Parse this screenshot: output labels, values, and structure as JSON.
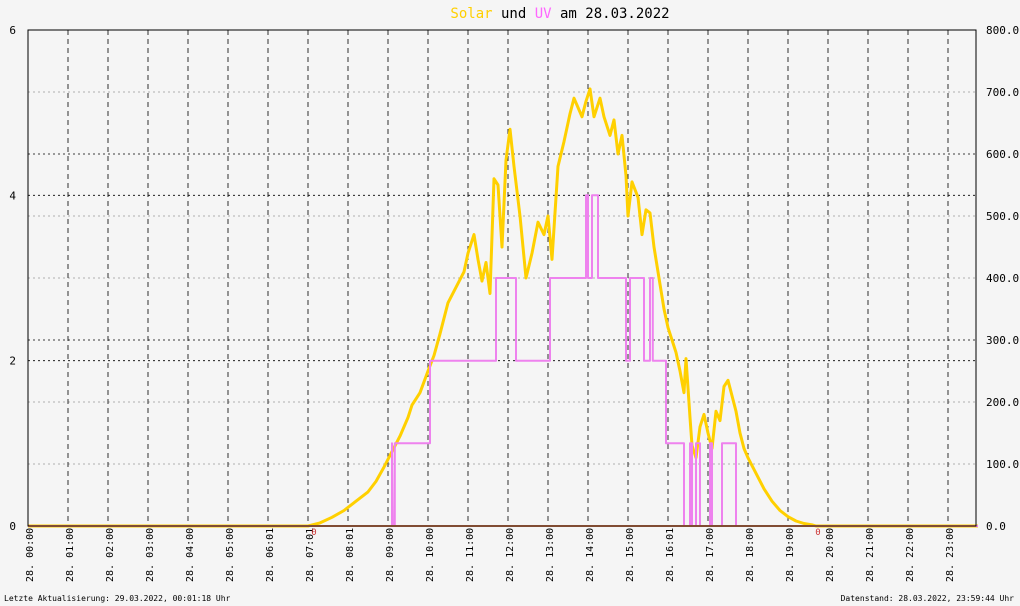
{
  "chart_data": {
    "type": "line",
    "title": {
      "parts": [
        {
          "text": "Solar",
          "color": "#ffd000"
        },
        {
          "text": " und ",
          "color": "#000000"
        },
        {
          "text": "UV",
          "color": "#ff66ff"
        },
        {
          "text": " am 28.03.2022",
          "color": "#000000"
        }
      ]
    },
    "x_axis": {
      "tick_labels": [
        "28. 00:00",
        "28. 01:00",
        "28. 02:00",
        "28. 03:00",
        "28. 04:00",
        "28. 05:00",
        "28. 06:01",
        "28. 07:01",
        "28. 08:01",
        "28. 09:00",
        "28. 10:00",
        "28. 11:00",
        "28. 12:00",
        "28. 13:00",
        "28. 14:00",
        "28. 15:00",
        "28. 16:01",
        "28. 17:00",
        "28. 18:00",
        "28. 19:00",
        "28. 20:00",
        "28. 21:00",
        "28. 22:00",
        "28. 23:00"
      ],
      "range_hours": [
        0,
        23.75
      ]
    },
    "y_left": {
      "range": [
        0,
        6
      ],
      "ticks": [
        "0",
        "2",
        "4",
        "6"
      ]
    },
    "y_right": {
      "range": [
        0,
        800
      ],
      "ticks": [
        "0.0",
        "100.0",
        "200.0",
        "300.0",
        "400.0",
        "500.0",
        "600.0",
        "700.0",
        "800.0"
      ]
    },
    "grid": true,
    "series": [
      {
        "name": "Solar",
        "axis": "right",
        "color": "#ffd000",
        "points": [
          [
            0,
            0
          ],
          [
            7.0,
            0
          ],
          [
            7.3,
            5
          ],
          [
            7.6,
            14
          ],
          [
            7.9,
            25
          ],
          [
            8.2,
            40
          ],
          [
            8.5,
            55
          ],
          [
            8.7,
            72
          ],
          [
            8.9,
            95
          ],
          [
            9.1,
            120
          ],
          [
            9.3,
            145
          ],
          [
            9.5,
            175
          ],
          [
            9.6,
            195
          ],
          [
            9.8,
            215
          ],
          [
            10.0,
            250
          ],
          [
            10.15,
            275
          ],
          [
            10.3,
            310
          ],
          [
            10.5,
            360
          ],
          [
            10.7,
            385
          ],
          [
            10.9,
            410
          ],
          [
            11.0,
            440
          ],
          [
            11.15,
            470
          ],
          [
            11.25,
            430
          ],
          [
            11.35,
            395
          ],
          [
            11.45,
            425
          ],
          [
            11.55,
            375
          ],
          [
            11.65,
            560
          ],
          [
            11.75,
            550
          ],
          [
            11.85,
            450
          ],
          [
            11.95,
            590
          ],
          [
            12.05,
            640
          ],
          [
            12.15,
            580
          ],
          [
            12.3,
            500
          ],
          [
            12.45,
            400
          ],
          [
            12.6,
            440
          ],
          [
            12.75,
            490
          ],
          [
            12.9,
            470
          ],
          [
            13.0,
            500
          ],
          [
            13.1,
            430
          ],
          [
            13.25,
            580
          ],
          [
            13.4,
            620
          ],
          [
            13.55,
            665
          ],
          [
            13.65,
            690
          ],
          [
            13.75,
            675
          ],
          [
            13.85,
            660
          ],
          [
            13.95,
            685
          ],
          [
            14.05,
            705
          ],
          [
            14.15,
            660
          ],
          [
            14.3,
            690
          ],
          [
            14.4,
            660
          ],
          [
            14.55,
            630
          ],
          [
            14.65,
            655
          ],
          [
            14.75,
            600
          ],
          [
            14.85,
            630
          ],
          [
            14.95,
            565
          ],
          [
            15.0,
            500
          ],
          [
            15.1,
            555
          ],
          [
            15.25,
            530
          ],
          [
            15.35,
            470
          ],
          [
            15.45,
            510
          ],
          [
            15.55,
            505
          ],
          [
            15.65,
            450
          ],
          [
            15.8,
            390
          ],
          [
            15.9,
            350
          ],
          [
            16.0,
            320
          ],
          [
            16.1,
            300
          ],
          [
            16.2,
            280
          ],
          [
            16.3,
            250
          ],
          [
            16.4,
            215
          ],
          [
            16.45,
            270
          ],
          [
            16.55,
            175
          ],
          [
            16.6,
            130
          ],
          [
            16.7,
            110
          ],
          [
            16.8,
            160
          ],
          [
            16.9,
            180
          ],
          [
            17.0,
            150
          ],
          [
            17.1,
            125
          ],
          [
            17.2,
            185
          ],
          [
            17.3,
            170
          ],
          [
            17.4,
            225
          ],
          [
            17.5,
            235
          ],
          [
            17.6,
            210
          ],
          [
            17.7,
            185
          ],
          [
            17.8,
            150
          ],
          [
            17.9,
            125
          ],
          [
            18.0,
            110
          ],
          [
            18.2,
            85
          ],
          [
            18.4,
            60
          ],
          [
            18.6,
            40
          ],
          [
            18.8,
            25
          ],
          [
            19.0,
            15
          ],
          [
            19.2,
            8
          ],
          [
            19.4,
            4
          ],
          [
            19.6,
            2
          ],
          [
            19.7,
            0
          ],
          [
            23.75,
            0
          ]
        ]
      },
      {
        "name": "UV",
        "axis": "left",
        "color": "#ee82ee",
        "points": [
          [
            7.0,
            0
          ],
          [
            9.1,
            0
          ],
          [
            9.1,
            1
          ],
          [
            9.12,
            0
          ],
          [
            9.17,
            0
          ],
          [
            9.17,
            1
          ],
          [
            10.05,
            1
          ],
          [
            10.05,
            2
          ],
          [
            11.7,
            2
          ],
          [
            11.7,
            3
          ],
          [
            12.2,
            3
          ],
          [
            12.2,
            2
          ],
          [
            13.05,
            2
          ],
          [
            13.05,
            3
          ],
          [
            13.95,
            3
          ],
          [
            13.95,
            4
          ],
          [
            14.0,
            4
          ],
          [
            14.0,
            3
          ],
          [
            14.1,
            3
          ],
          [
            14.1,
            4
          ],
          [
            14.25,
            4
          ],
          [
            14.25,
            3
          ],
          [
            14.95,
            3
          ],
          [
            14.95,
            2
          ],
          [
            15.05,
            2
          ],
          [
            15.05,
            3
          ],
          [
            15.4,
            3
          ],
          [
            15.4,
            2
          ],
          [
            15.55,
            2
          ],
          [
            15.55,
            3
          ],
          [
            15.62,
            3
          ],
          [
            15.62,
            2
          ],
          [
            15.95,
            2
          ],
          [
            15.95,
            1
          ],
          [
            16.4,
            1
          ],
          [
            16.4,
            0
          ],
          [
            16.55,
            0
          ],
          [
            16.55,
            1
          ],
          [
            16.6,
            1
          ],
          [
            16.6,
            0
          ],
          [
            16.7,
            0
          ],
          [
            16.7,
            1
          ],
          [
            16.8,
            1
          ],
          [
            16.8,
            0
          ],
          [
            17.05,
            0
          ],
          [
            17.05,
            1
          ],
          [
            17.1,
            1
          ],
          [
            17.1,
            0
          ],
          [
            17.35,
            0
          ],
          [
            17.35,
            1
          ],
          [
            17.7,
            1
          ],
          [
            17.7,
            0
          ],
          [
            23.75,
            0
          ]
        ]
      }
    ]
  },
  "footer": {
    "left": "Letzte Aktualisierung: 29.03.2022, 00:01:18 Uhr",
    "right": "Datenstand: 28.03.2022, 23:59:44 Uhr"
  }
}
